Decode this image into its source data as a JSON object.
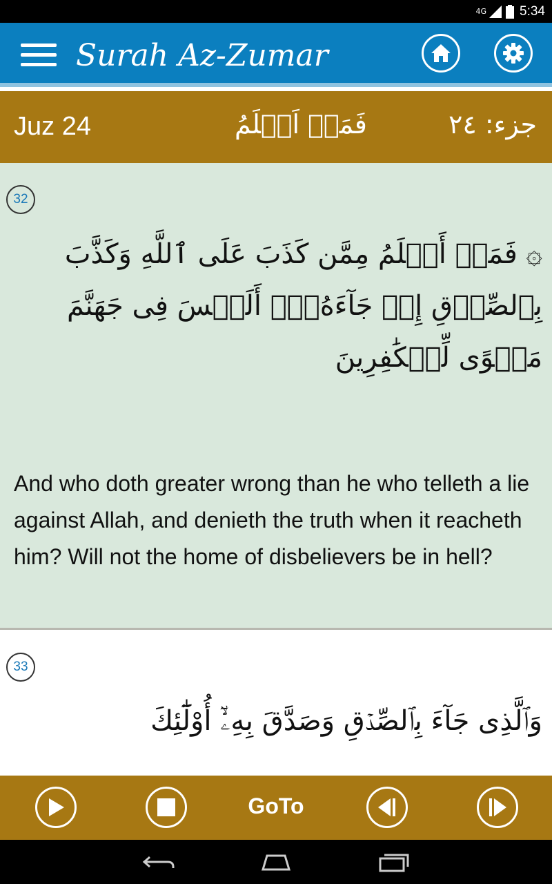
{
  "status_bar": {
    "network": "4G",
    "time": "5:34"
  },
  "app_bar": {
    "title": "Surah Az-Zumar"
  },
  "juz_bar": {
    "english": "Juz 24",
    "juz_word": "فَمَنۡ اَظۡلَمُ",
    "arabic": "جزء: ٢٤"
  },
  "verses": [
    {
      "number": "32",
      "arabic_lines": [
        "۞ فَمَنۡ أَظۡلَمُ مِمَّن كَذَبَ عَلَى ٱللَّهِ وَكَذَّبَ",
        "بِٱلصِّدۡقِ إِذۡ جَآءَهُۥٓۚ أَلَيۡسَ فِى جَهَنَّمَ",
        "مَثۡوًى لِّلۡكَٰفِرِينَ"
      ],
      "translation": "And who doth greater wrong than he who telleth a lie against Allah, and denieth the truth when it reacheth him? Will not the home of disbelievers be in hell?"
    },
    {
      "number": "33",
      "arabic_lines": [
        "وَٱلَّذِى جَآءَ بِٱلصِّدۡقِ وَصَدَّقَ بِهِۦٓۙ أُوْلَٰٓئِكَ"
      ]
    }
  ],
  "player": {
    "goto_label": "GoTo"
  },
  "colors": {
    "app_bar": "#0b7fbf",
    "gold_bar": "#a77813",
    "verse_bg": "#d9e8dc",
    "verse_number": "#1a79b8"
  }
}
